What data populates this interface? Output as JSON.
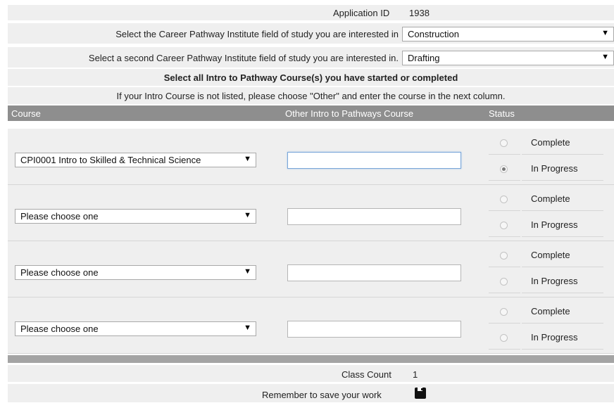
{
  "application": {
    "label": "Application ID",
    "value": "1938"
  },
  "field1": {
    "label": "Select the Career Pathway Institute field of study you are interested in",
    "selected": "Construction"
  },
  "field2": {
    "label": "Select a second Career Pathway Institute field of study you are interested in.",
    "selected": "Drafting"
  },
  "instructions": {
    "heading": "Select all Intro to Pathway Course(s) you have started or completed",
    "note": "If your Intro Course is not listed, please choose \"Other\" and enter the course in the next column."
  },
  "table": {
    "headers": {
      "course": "Course",
      "other": "Other Intro to Pathways Course",
      "status": "Status"
    },
    "rows": [
      {
        "course": "CPI0001 Intro to Skilled & Technical Science",
        "other": "",
        "status_options": [
          "Complete",
          "In Progress"
        ],
        "selected_status": "In Progress"
      },
      {
        "course": "Please choose one",
        "other": "",
        "status_options": [
          "Complete",
          "In Progress"
        ],
        "selected_status": ""
      },
      {
        "course": "Please choose one",
        "other": "",
        "status_options": [
          "Complete",
          "In Progress"
        ],
        "selected_status": ""
      },
      {
        "course": "Please choose one",
        "other": "",
        "status_options": [
          "Complete",
          "In Progress"
        ],
        "selected_status": ""
      }
    ]
  },
  "class_count": {
    "label": "Class Count",
    "value": "1"
  },
  "save": {
    "label": "Remember to save your work",
    "icon": "floppy-disk-icon"
  },
  "icons": {
    "dropdown": "▼"
  }
}
